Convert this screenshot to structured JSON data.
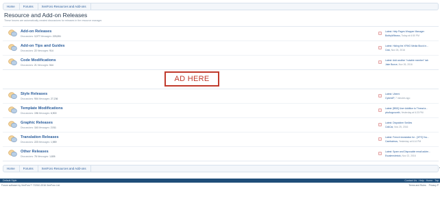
{
  "breadcrumb": {
    "items": [
      "Home",
      "Forums",
      "XenForo Resources and Add-ons"
    ]
  },
  "header": {
    "title": "Resource and Add-on Releases",
    "description": "These forums are automatically created discussions for releases in the resource manager."
  },
  "ad": {
    "label": "AD HERE"
  },
  "forums_top": [
    {
      "title": "Add-on Releases",
      "discussions_label": "Discussions:",
      "discussions": "3,077",
      "messages_label": "Messages:",
      "messages": "225,051",
      "latest": "Latest: Help Pages Wrapper Manager",
      "latest_who": "BobbyWibowo,",
      "latest_when": "Today at 6:50 PM"
    },
    {
      "title": "Add-on Tips and Guides",
      "discussions_label": "Discussions:",
      "discussions": "22",
      "messages_label": "Messages:",
      "messages": "914",
      "latest": "Latest: Hiding the XFMG Media Block in...",
      "latest_who": "Cdsi,",
      "latest_when": "Nov 26, 2016"
    },
    {
      "title": "Code Modifications",
      "discussions_label": "Discussions:",
      "discussions": "21",
      "messages_label": "Messages:",
      "messages": "544",
      "latest": "Latest: Add another \"notable member\" tab",
      "latest_who": "Jake Bunce,",
      "latest_when": "Nov 26, 2016"
    }
  ],
  "forums_bottom": [
    {
      "title": "Style Releases",
      "discussions_label": "Discussions:",
      "discussions": "904",
      "messages_label": "Messages:",
      "messages": "27,236",
      "latest": "Latest: Uberni",
      "latest_who": "CyberAP,",
      "latest_when": "7 minutes ago"
    },
    {
      "title": "Template Modifications",
      "discussions_label": "Discussions:",
      "discussions": "196",
      "messages_label": "Messages:",
      "messages": "6,900",
      "latest": "Latest: [BBD] User Addition to Thread a...",
      "latest_who": "pkcAngusonth,",
      "latest_when": "Yesterday at 6:20 PM"
    },
    {
      "title": "Graphic Releases",
      "discussions_label": "Discussions:",
      "discussions": "116",
      "messages_label": "Messages:",
      "messages": "2,911",
      "latest": "Latest: Dispatcher Smilies",
      "latest_who": "CdkCar,",
      "latest_when": "Nov 25, 2016"
    },
    {
      "title": "Translation Releases",
      "discussions_label": "Discussions:",
      "discussions": "223",
      "messages_label": "Messages:",
      "messages": "1,989",
      "latest": "Latest: French translation for - [XFS] You...",
      "latest_who": "Cambaimos,",
      "latest_when": "Yesterday at 6:14 PM"
    },
    {
      "title": "Other Releases",
      "discussions_label": "Discussions:",
      "discussions": "76",
      "messages_label": "Messages:",
      "messages": "1,826",
      "latest": "Latest: Spam and Disposable email addre...",
      "latest_who": "Escalenshmick,",
      "latest_when": "Nov 22, 2016"
    }
  ],
  "footer": {
    "style_label": "Default Style",
    "links": [
      "Contact Us",
      "Help",
      "Home",
      "Top"
    ],
    "copyright": "Forum software by XenForo™ ©2010-2016 XenForo Ltd.",
    "legal": [
      "Terms and Rules",
      "Privacy P"
    ]
  },
  "colors": {
    "accent": "#2b5e9c",
    "footer": "#1f4e79",
    "ad_border": "#c0392b"
  },
  "icons": [
    "forum-bubble-icon",
    "rss-icon",
    "scroll-up-icon"
  ]
}
